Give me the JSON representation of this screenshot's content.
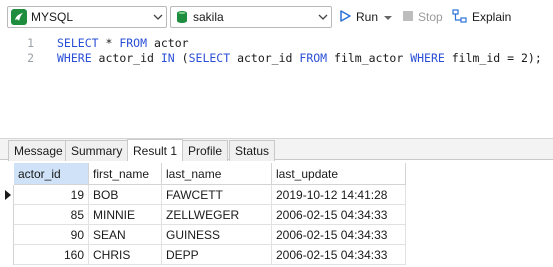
{
  "toolbar": {
    "connection": "MYSQL",
    "database": "sakila",
    "run_label": "Run",
    "stop_label": "Stop",
    "explain_label": "Explain"
  },
  "editor": {
    "line_numbers": [
      "1",
      "2"
    ],
    "line1": {
      "kw_select": "SELECT",
      "star": " * ",
      "kw_from": "FROM",
      "table": " actor"
    },
    "line2": {
      "kw_where": "WHERE",
      "p1": " actor_id ",
      "kw_in": "IN",
      "p2": " (",
      "kw_select": "SELECT",
      "p3": " actor_id ",
      "kw_from": "FROM",
      "p4": " film_actor ",
      "p5": " film_id = ",
      "num": "2",
      "p6": ");"
    }
  },
  "tabs": [
    "Message",
    "Summary",
    "Result 1",
    "Profile",
    "Status"
  ],
  "active_tab": "Result 1",
  "grid": {
    "columns": [
      "actor_id",
      "first_name",
      "last_name",
      "last_update"
    ],
    "rows": [
      [
        "19",
        "BOB",
        "FAWCETT",
        "2019-10-12 14:41:28"
      ],
      [
        "85",
        "MINNIE",
        "ZELLWEGER",
        "2006-02-15 04:34:33"
      ],
      [
        "90",
        "SEAN",
        "GUINESS",
        "2006-02-15 04:34:33"
      ],
      [
        "160",
        "CHRIS",
        "DEPP",
        "2006-02-15 04:34:33"
      ]
    ]
  },
  "colors": {
    "keyword": "#2a4fd6",
    "connection_icon": "#1e8e3e",
    "database_icon": "#1e8e3e",
    "run_icon": "#2a72d6",
    "selected_header": "#cfe2f7"
  },
  "icons": {
    "connection": "mysql-icon",
    "database": "database-icon",
    "run": "play-icon",
    "stop": "stop-icon",
    "explain": "explain-icon"
  }
}
